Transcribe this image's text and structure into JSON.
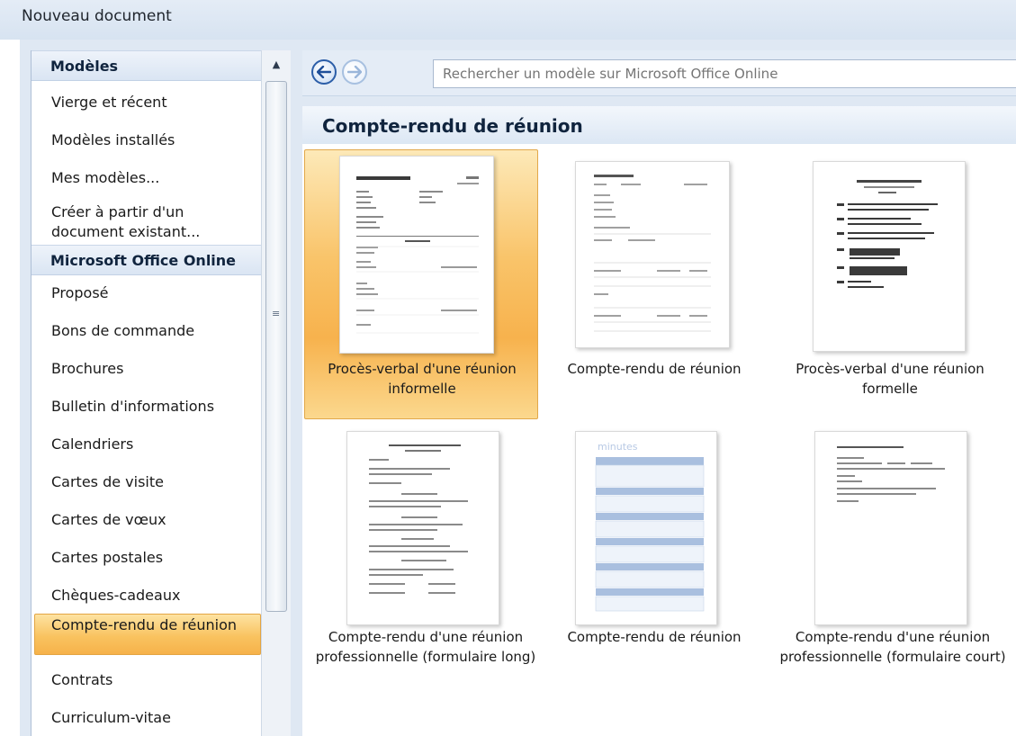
{
  "window": {
    "title": "Nouveau document"
  },
  "sidebar": {
    "section_models": "Modèles",
    "section_online": "Microsoft Office Online",
    "items_top": [
      "Vierge et récent",
      "Modèles installés",
      "Mes modèles...",
      "Créer à partir d'un document existant..."
    ],
    "items_online": [
      "Proposé",
      "Bons de commande",
      "Brochures",
      "Bulletin d'informations",
      "Calendriers",
      "Cartes de visite",
      "Cartes de vœux",
      "Cartes postales",
      "Chèques-cadeaux",
      "Compte-rendu de réunion",
      "Contrats",
      "Curriculum-vitae"
    ],
    "selected": "Compte-rendu de réunion"
  },
  "search": {
    "placeholder": "Rechercher un modèle sur Microsoft Office Online"
  },
  "content": {
    "title": "Compte-rendu de réunion",
    "templates": [
      {
        "label": "Procès-verbal d'une réunion informelle",
        "selected": true
      },
      {
        "label": "Compte-rendu de réunion",
        "selected": false
      },
      {
        "label": "Procès-verbal d'une réunion formelle",
        "selected": false
      },
      {
        "label": "Compte-rendu d'une réunion professionnelle (formulaire long)",
        "selected": false
      },
      {
        "label": "Compte-rendu de réunion",
        "selected": false
      },
      {
        "label": "Compte-rendu d'une réunion professionnelle (formulaire court)",
        "selected": false
      }
    ],
    "thumbnail_header_text": "minutes"
  },
  "colors": {
    "selection": "#f9c360",
    "header_bg": "#dae5f3",
    "accent_blue": "#2c5ea8"
  }
}
